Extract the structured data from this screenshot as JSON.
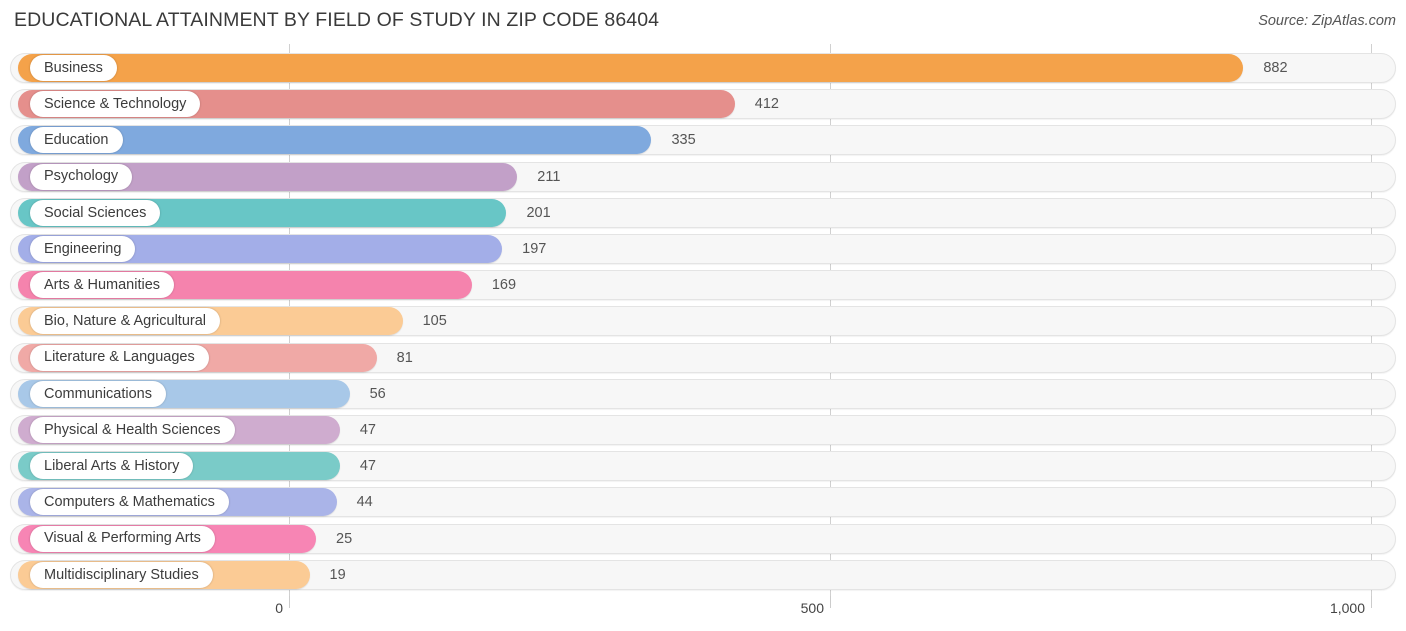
{
  "header": {
    "title": "EDUCATIONAL ATTAINMENT BY FIELD OF STUDY IN ZIP CODE 86404",
    "source": "Source: ZipAtlas.com"
  },
  "chart_data": {
    "type": "bar",
    "orientation": "horizontal",
    "title": "EDUCATIONAL ATTAINMENT BY FIELD OF STUDY IN ZIP CODE 86404",
    "xlabel": "",
    "ylabel": "",
    "xlim": [
      0,
      1000
    ],
    "grid": true,
    "legend": "none",
    "categories": [
      "Business",
      "Science & Technology",
      "Education",
      "Psychology",
      "Social Sciences",
      "Engineering",
      "Arts & Humanities",
      "Bio, Nature & Agricultural",
      "Literature & Languages",
      "Communications",
      "Physical & Health Sciences",
      "Liberal Arts & History",
      "Computers & Mathematics",
      "Visual & Performing Arts",
      "Multidisciplinary Studies"
    ],
    "values": [
      882,
      412,
      335,
      211,
      201,
      197,
      169,
      105,
      81,
      56,
      47,
      47,
      44,
      25,
      19
    ],
    "value_labels": [
      "882",
      "412",
      "335",
      "211",
      "201",
      "197",
      "169",
      "105",
      "81",
      "56",
      "47",
      "47",
      "44",
      "25",
      "19"
    ],
    "colors": [
      "#f5a council",
      "#ea9"
    ],
    "bar_colors": [
      "#f4a24a",
      "#e58f8c",
      "#7fa9de",
      "#c2a0c8",
      "#68c6c6",
      "#a3aee8",
      "#f583ad",
      "#fbcb95",
      "#f0a9a6",
      "#a8c8e8",
      "#cfaccf",
      "#7acbc8",
      "#aab4e8",
      "#f785b4",
      "#fbcb95"
    ],
    "xticks": [
      0,
      500,
      1000
    ],
    "xtick_labels": [
      "0",
      "500",
      "1,000"
    ]
  },
  "axis": {
    "ticks": [
      {
        "label": "0",
        "value": 0
      },
      {
        "label": "500",
        "value": 500
      },
      {
        "label": "1,000",
        "value": 1000
      }
    ]
  }
}
